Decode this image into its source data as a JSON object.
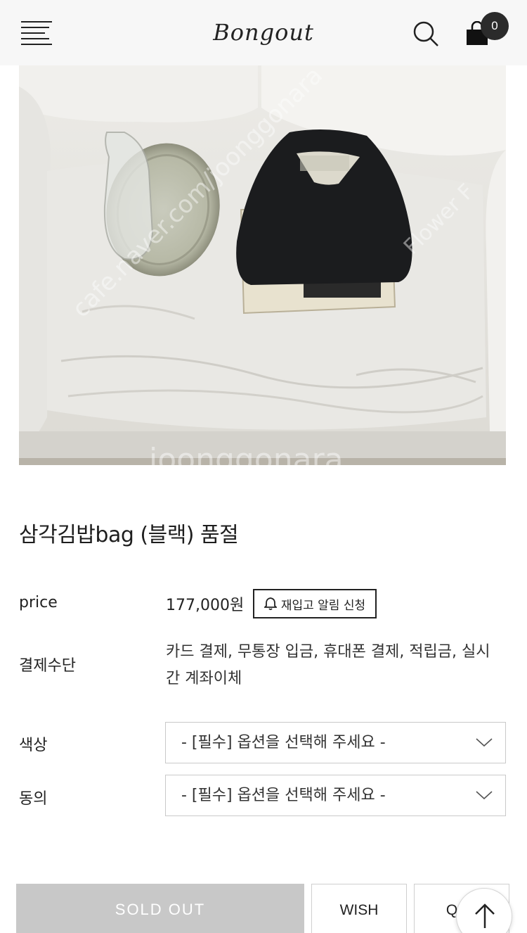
{
  "header": {
    "logo_text": "Bongout",
    "cart_count": "0"
  },
  "product": {
    "title": "삼각김밥bag (블랙) 품절",
    "price_label": "price",
    "price_value": "177,000원",
    "restock_label": "재입고 알림 신청",
    "payment_label": "결제수단",
    "payment_methods": "카드 결제, 무통장 입금, 휴대폰 결제, 적립금, 실시간 계좌이체",
    "color_label": "색상",
    "color_select_value": "- [필수] 옵션을 선택해 주세요 -",
    "agree_label": "동의",
    "agree_select_value": "- [필수] 옵션을 선택해 주세요 -"
  },
  "actions": {
    "soldout_label": "SOLD OUT",
    "wish_label": "WISH",
    "qa_label": "Q&A"
  },
  "image": {
    "watermark_1": "cafe.naver.com/joonggonara",
    "watermark_2": "Flower F",
    "watermark_3": "joonggonara"
  },
  "colors": {
    "header_bg": "#f7f7f7",
    "soldout_bg": "#c8c8c8",
    "badge_bg": "#2b2b2b"
  }
}
